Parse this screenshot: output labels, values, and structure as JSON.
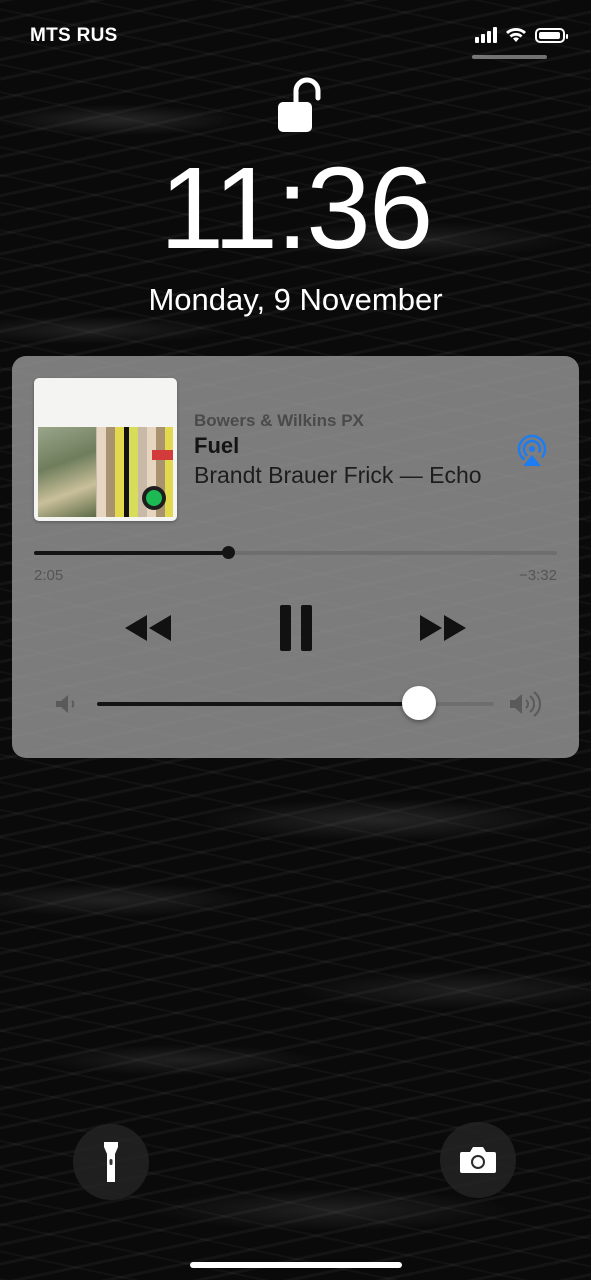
{
  "status_bar": {
    "carrier": "MTS RUS",
    "battery_level": 0.9,
    "signal_bars": 4
  },
  "lock_screen": {
    "time": "11:36",
    "date": "Monday, 9 November",
    "lock_icon": "unlocked-padlock-icon"
  },
  "now_playing": {
    "device": "Bowers & Wilkins PX",
    "title": "Fuel",
    "artist_album": "Brandt Brauer Frick — Echo",
    "elapsed": "2:05",
    "remaining": "−3:32",
    "progress": 0.371,
    "volume": 0.81,
    "airplay_color": "#1e7cf2",
    "controls": [
      "rewind-icon",
      "pause-icon",
      "fast-forward-icon"
    ],
    "artwork_badge": "spotify-icon"
  },
  "bottom_actions": {
    "left": "flashlight-icon",
    "right": "camera-icon"
  }
}
